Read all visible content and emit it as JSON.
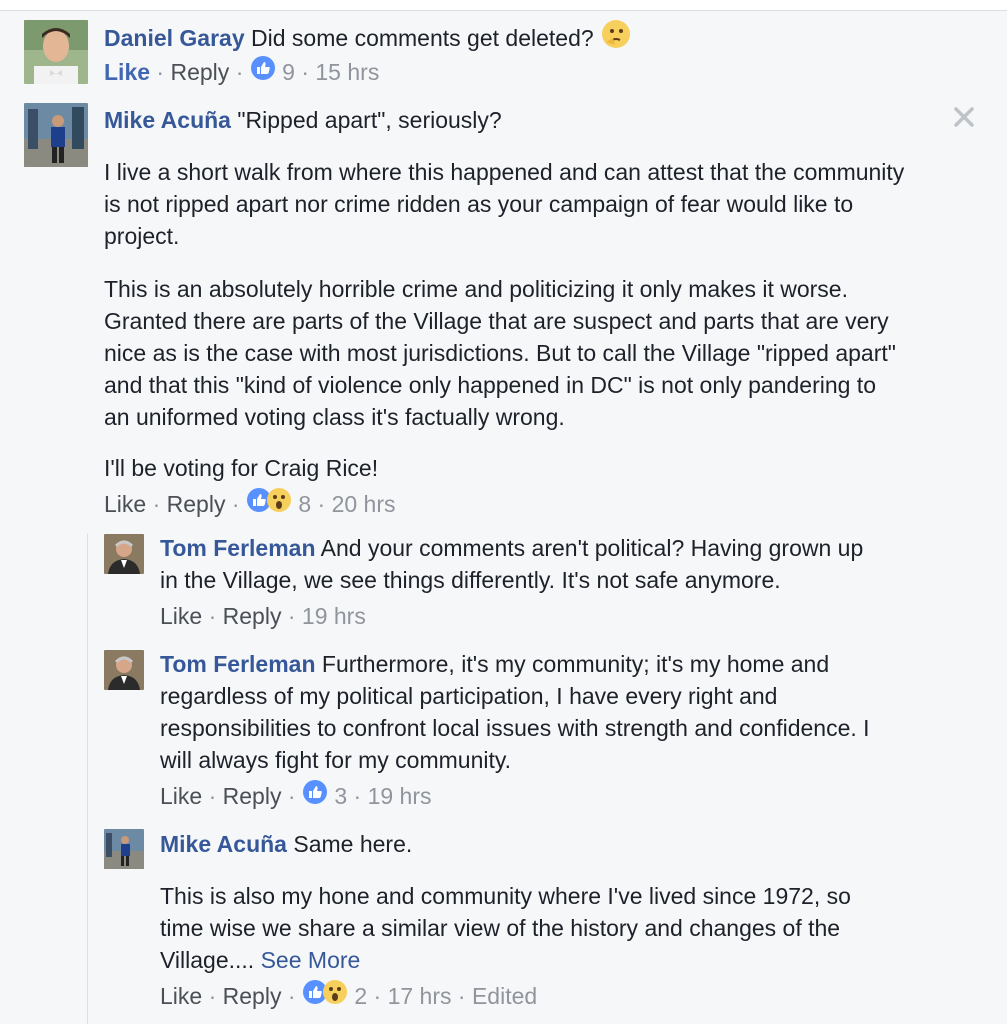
{
  "comments": {
    "c1": {
      "author": "Daniel Garay",
      "text": "Did some comments get deleted?",
      "like": "Like",
      "reply": "Reply",
      "reactions": "9",
      "time": "15 hrs"
    },
    "c2": {
      "author": "Mike Acuña",
      "text": "\"Ripped apart\", seriously?",
      "para1_l1": "I live a short walk from where this happened and can attest that the community",
      "para1_l2": "is not ripped apart nor crime ridden as your campaign of fear would like to",
      "para1_l3": "project.",
      "para2_l1": "This is an absolutely horrible crime and politicizing it only makes it worse.",
      "para2_l2": "Granted there are parts of the Village that are suspect and parts that are very",
      "para2_l3": "nice as is the case with most jurisdictions. But to call the Village \"ripped apart\"",
      "para2_l4": "and that this \"kind of violence only happened in DC\" is not only pandering to",
      "para2_l5": "an uniformed voting class it's factually wrong.",
      "para3": "I'll be voting for Craig Rice!",
      "like": "Like",
      "reply": "Reply",
      "reactions": "8",
      "time": "20 hrs"
    },
    "c3": {
      "author": "Tom Ferleman",
      "text_l1": "And your comments aren't political? Having grown up",
      "text_l2": "in the Village, we see things differently. It's not safe anymore.",
      "like": "Like",
      "reply": "Reply",
      "time": "19 hrs"
    },
    "c4": {
      "author": "Tom Ferleman",
      "text_l1": "Furthermore, it's my community; it's my home and",
      "text_l2": "regardless of my political participation, I have every right and",
      "text_l3": "responsibilities to confront local issues with strength and confidence. I",
      "text_l4": "will always fight for my community.",
      "like": "Like",
      "reply": "Reply",
      "reactions": "3",
      "time": "19 hrs"
    },
    "c5": {
      "author": "Mike Acuña",
      "text": "Same here.",
      "para_l1": "This is also my hone and community where I've lived since 1972, so",
      "para_l2": "time wise we share a similar view of the history and changes of the",
      "para_l3": "Village....",
      "see_more": "See More",
      "like": "Like",
      "reply": "Reply",
      "reactions": "2",
      "time": "17 hrs",
      "edited": "Edited"
    }
  },
  "sep": "·",
  "colors": {
    "link": "#365899",
    "like_blue": "#4267b2",
    "meta": "#90949c",
    "bg": "#f6f7f9"
  }
}
